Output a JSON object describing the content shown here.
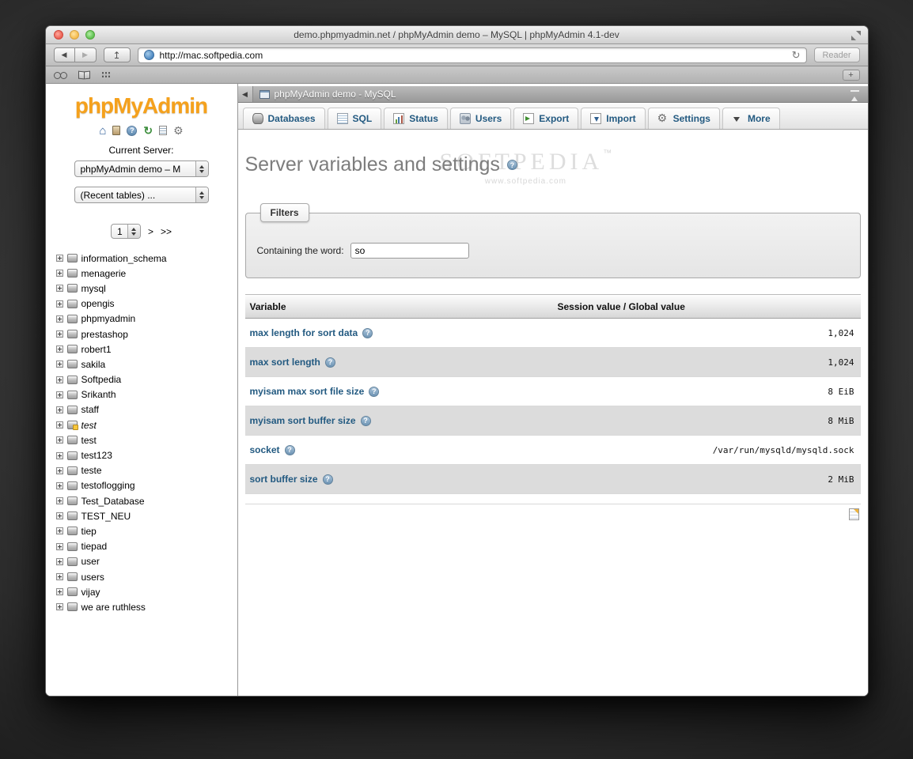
{
  "browser": {
    "window_title": "demo.phpmyadmin.net / phpMyAdmin demo – MySQL | phpMyAdmin 4.1-dev",
    "url": "http://mac.softpedia.com",
    "reader_label": "Reader",
    "icons": {
      "back": "◀",
      "forward": "▶",
      "share": "↥",
      "reload": "↻",
      "new_tab": "+",
      "collapse_left": "◀"
    }
  },
  "pma": {
    "logo": "phpMyAdmin",
    "current_server_label": "Current Server:",
    "server_selected": "phpMyAdmin demo – M",
    "recent_tables_selected": "(Recent tables) ...",
    "page_number": "1",
    "page_next": ">",
    "page_last": ">>",
    "databases": [
      {
        "name": "information_schema"
      },
      {
        "name": "menagerie"
      },
      {
        "name": "mysql"
      },
      {
        "name": "opengis"
      },
      {
        "name": "phpmyadmin"
      },
      {
        "name": "prestashop"
      },
      {
        "name": "robert1"
      },
      {
        "name": "sakila"
      },
      {
        "name": "Softpedia"
      },
      {
        "name": "Srikanth"
      },
      {
        "name": "staff"
      },
      {
        "name": "test",
        "italic": true,
        "special": true
      },
      {
        "name": "test"
      },
      {
        "name": "test123"
      },
      {
        "name": "teste"
      },
      {
        "name": "testoflogging"
      },
      {
        "name": "Test_Database"
      },
      {
        "name": "TEST_NEU"
      },
      {
        "name": "tiep"
      },
      {
        "name": "tiepad"
      },
      {
        "name": "user"
      },
      {
        "name": "users"
      },
      {
        "name": "vijay"
      },
      {
        "name": "we are ruthless"
      }
    ]
  },
  "main": {
    "header_title": "phpMyAdmin demo - MySQL",
    "tabs": [
      {
        "label": "Databases",
        "icon": "databases"
      },
      {
        "label": "SQL",
        "icon": "sql"
      },
      {
        "label": "Status",
        "icon": "status"
      },
      {
        "label": "Users",
        "icon": "users"
      },
      {
        "label": "Export",
        "icon": "export"
      },
      {
        "label": "Import",
        "icon": "import"
      },
      {
        "label": "Settings",
        "icon": "settings"
      },
      {
        "label": "More",
        "icon": "more"
      }
    ],
    "page_title": "Server variables and settings",
    "watermark": {
      "brand": "SOFTPEDIA",
      "tm": "™",
      "site": "www.softpedia.com"
    },
    "filters": {
      "legend": "Filters",
      "label": "Containing the word:",
      "value": "so"
    },
    "variables_table": {
      "columns": [
        "Variable",
        "Session value / Global value"
      ],
      "rows": [
        {
          "name": "max length for sort data",
          "value": "1,024"
        },
        {
          "name": "max sort length",
          "value": "1,024"
        },
        {
          "name": "myisam max sort file size",
          "value": "8 EiB"
        },
        {
          "name": "myisam sort buffer size",
          "value": "8 MiB"
        },
        {
          "name": "socket",
          "value": "/var/run/mysqld/mysqld.sock"
        },
        {
          "name": "sort buffer size",
          "value": "2 MiB"
        }
      ]
    }
  }
}
